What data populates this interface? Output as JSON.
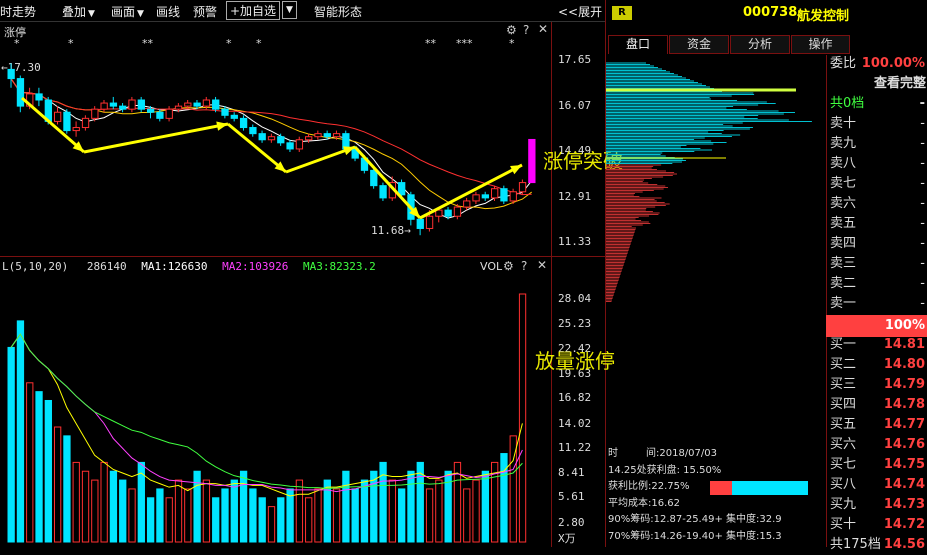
{
  "toolbar": {
    "timeshare": "时走势",
    "overlay": "叠加",
    "drawing": "画面",
    "line": "画线",
    "alert": "预警",
    "add_favorite": "+加自选",
    "smart_pattern": "智能形态",
    "expand": "<<展开"
  },
  "price_chart": {
    "title": "涨停",
    "high_marker": "←17.30",
    "low_marker": "11.68→",
    "axis_ticks": [
      "17.65",
      "16.07",
      "14.49",
      "12.91",
      "11.33"
    ],
    "annotation": "涨停突破",
    "stars": [
      "*",
      "*",
      "**",
      "*",
      "*",
      "**",
      "***",
      "*"
    ]
  },
  "volume_chart": {
    "indicator": "L(5,10,20)",
    "volume": "286140",
    "ma1_label": "MA1:126630",
    "ma2_label": "MA2:103926",
    "ma3_label": "MA3:82323.2",
    "name": "VOL",
    "axis_ticks": [
      "28.04",
      "25.23",
      "22.42",
      "19.63",
      "16.82",
      "14.02",
      "11.22",
      "8.41",
      "5.61",
      "2.80"
    ],
    "unit": "X万",
    "annotation": "放量涨停"
  },
  "colors": {
    "up": "#ff3030",
    "down": "#00e5ff",
    "ma1": "#ffffff",
    "ma2": "#ff40ff",
    "ma3": "#40ff40",
    "accent": "#ffff00"
  },
  "stock": {
    "badge": "R",
    "code": "000738",
    "name": "航发控制"
  },
  "tabs": [
    "盘口",
    "资金",
    "分析",
    "操作"
  ],
  "chip": {
    "time_label": "时",
    "date": "间:2018/07/03",
    "profit_at": "14.25处获利盘: 15.50%",
    "profit_ratio": "获利比例:22.75%",
    "avg_cost": "平均成本:16.62",
    "chip90": "90%筹码:12.87-25.49+ 集中度:32.9",
    "chip70": "70%筹码:14.26-19.40+ 集中度:15.3",
    "profit_fraction": 0.2275
  },
  "orderbook": {
    "ratio_label": "委比",
    "ratio_value": "100.00%",
    "view_all": "查看完整",
    "total_levels": "共0档",
    "middle_pct": "100%",
    "asks": [
      {
        "label": "卖十",
        "value": "-"
      },
      {
        "label": "卖九",
        "value": "-"
      },
      {
        "label": "卖八",
        "value": "-"
      },
      {
        "label": "卖七",
        "value": "-"
      },
      {
        "label": "卖六",
        "value": "-"
      },
      {
        "label": "卖五",
        "value": "-"
      },
      {
        "label": "卖四",
        "value": "-"
      },
      {
        "label": "卖三",
        "value": "-"
      },
      {
        "label": "卖二",
        "value": "-"
      },
      {
        "label": "卖一",
        "value": "-"
      }
    ],
    "bids": [
      {
        "label": "买一",
        "value": "14.81"
      },
      {
        "label": "买二",
        "value": "14.80"
      },
      {
        "label": "买三",
        "value": "14.79"
      },
      {
        "label": "买四",
        "value": "14.78"
      },
      {
        "label": "买五",
        "value": "14.77"
      },
      {
        "label": "买六",
        "value": "14.76"
      },
      {
        "label": "买七",
        "value": "14.75"
      },
      {
        "label": "买八",
        "value": "14.74"
      },
      {
        "label": "买九",
        "value": "14.73"
      },
      {
        "label": "买十",
        "value": "14.72"
      },
      {
        "label": "共175档",
        "value": "14.56"
      }
    ]
  },
  "chart_data": {
    "type": "candlestick",
    "ylim": [
      11.0,
      17.8
    ],
    "candles": [
      {
        "o": 17.1,
        "c": 16.8,
        "h": 17.3,
        "l": 16.5
      },
      {
        "o": 16.8,
        "c": 15.9,
        "h": 16.9,
        "l": 15.7
      },
      {
        "o": 15.9,
        "c": 16.3,
        "h": 16.5,
        "l": 15.8
      },
      {
        "o": 16.3,
        "c": 16.1,
        "h": 16.5,
        "l": 15.9
      },
      {
        "o": 16.1,
        "c": 15.4,
        "h": 16.2,
        "l": 15.3
      },
      {
        "o": 15.4,
        "c": 15.7,
        "h": 15.9,
        "l": 15.3
      },
      {
        "o": 15.7,
        "c": 15.1,
        "h": 15.8,
        "l": 15.0
      },
      {
        "o": 15.1,
        "c": 15.2,
        "h": 15.4,
        "l": 14.9
      },
      {
        "o": 15.2,
        "c": 15.5,
        "h": 15.6,
        "l": 15.1
      },
      {
        "o": 15.5,
        "c": 15.8,
        "h": 15.9,
        "l": 15.4
      },
      {
        "o": 15.8,
        "c": 16.0,
        "h": 16.1,
        "l": 15.7
      },
      {
        "o": 16.0,
        "c": 15.9,
        "h": 16.2,
        "l": 15.8
      },
      {
        "o": 15.9,
        "c": 15.8,
        "h": 16.0,
        "l": 15.7
      },
      {
        "o": 15.8,
        "c": 16.1,
        "h": 16.2,
        "l": 15.7
      },
      {
        "o": 16.1,
        "c": 15.8,
        "h": 16.2,
        "l": 15.7
      },
      {
        "o": 15.8,
        "c": 15.7,
        "h": 15.9,
        "l": 15.5
      },
      {
        "o": 15.7,
        "c": 15.5,
        "h": 15.8,
        "l": 15.4
      },
      {
        "o": 15.5,
        "c": 15.8,
        "h": 15.9,
        "l": 15.4
      },
      {
        "o": 15.8,
        "c": 15.9,
        "h": 16.0,
        "l": 15.7
      },
      {
        "o": 15.9,
        "c": 16.0,
        "h": 16.1,
        "l": 15.8
      },
      {
        "o": 16.0,
        "c": 15.9,
        "h": 16.1,
        "l": 15.8
      },
      {
        "o": 15.9,
        "c": 16.1,
        "h": 16.2,
        "l": 15.8
      },
      {
        "o": 16.1,
        "c": 15.8,
        "h": 16.2,
        "l": 15.7
      },
      {
        "o": 15.8,
        "c": 15.6,
        "h": 15.9,
        "l": 15.5
      },
      {
        "o": 15.6,
        "c": 15.5,
        "h": 15.7,
        "l": 15.4
      },
      {
        "o": 15.5,
        "c": 15.2,
        "h": 15.6,
        "l": 15.1
      },
      {
        "o": 15.2,
        "c": 15.0,
        "h": 15.3,
        "l": 14.9
      },
      {
        "o": 15.0,
        "c": 14.8,
        "h": 15.1,
        "l": 14.7
      },
      {
        "o": 14.8,
        "c": 14.9,
        "h": 15.0,
        "l": 14.7
      },
      {
        "o": 14.9,
        "c": 14.7,
        "h": 15.0,
        "l": 14.6
      },
      {
        "o": 14.7,
        "c": 14.5,
        "h": 14.8,
        "l": 14.4
      },
      {
        "o": 14.5,
        "c": 14.8,
        "h": 14.9,
        "l": 14.4
      },
      {
        "o": 14.8,
        "c": 14.9,
        "h": 15.0,
        "l": 14.7
      },
      {
        "o": 14.9,
        "c": 15.0,
        "h": 15.1,
        "l": 14.8
      },
      {
        "o": 15.0,
        "c": 14.9,
        "h": 15.1,
        "l": 14.8
      },
      {
        "o": 14.9,
        "c": 15.0,
        "h": 15.1,
        "l": 14.8
      },
      {
        "o": 15.0,
        "c": 14.5,
        "h": 15.1,
        "l": 14.4
      },
      {
        "o": 14.5,
        "c": 14.2,
        "h": 14.6,
        "l": 14.1
      },
      {
        "o": 14.2,
        "c": 13.8,
        "h": 14.3,
        "l": 13.7
      },
      {
        "o": 13.8,
        "c": 13.3,
        "h": 13.9,
        "l": 13.2
      },
      {
        "o": 13.3,
        "c": 12.9,
        "h": 13.4,
        "l": 12.8
      },
      {
        "o": 12.9,
        "c": 13.4,
        "h": 13.6,
        "l": 12.8
      },
      {
        "o": 13.4,
        "c": 13.0,
        "h": 13.5,
        "l": 12.9
      },
      {
        "o": 13.0,
        "c": 12.2,
        "h": 13.1,
        "l": 12.0
      },
      {
        "o": 12.2,
        "c": 11.9,
        "h": 12.3,
        "l": 11.68
      },
      {
        "o": 11.9,
        "c": 12.3,
        "h": 12.5,
        "l": 11.8
      },
      {
        "o": 12.3,
        "c": 12.5,
        "h": 12.6,
        "l": 12.1
      },
      {
        "o": 12.5,
        "c": 12.3,
        "h": 12.6,
        "l": 12.2
      },
      {
        "o": 12.3,
        "c": 12.6,
        "h": 12.7,
        "l": 12.2
      },
      {
        "o": 12.6,
        "c": 12.8,
        "h": 12.9,
        "l": 12.5
      },
      {
        "o": 12.8,
        "c": 13.0,
        "h": 13.1,
        "l": 12.7
      },
      {
        "o": 13.0,
        "c": 12.9,
        "h": 13.1,
        "l": 12.8
      },
      {
        "o": 12.9,
        "c": 13.2,
        "h": 13.3,
        "l": 12.8
      },
      {
        "o": 13.2,
        "c": 12.8,
        "h": 13.3,
        "l": 12.7
      },
      {
        "o": 12.8,
        "c": 13.1,
        "h": 13.2,
        "l": 12.7
      },
      {
        "o": 13.1,
        "c": 13.4,
        "h": 13.5,
        "l": 13.0
      },
      {
        "o": 13.4,
        "c": 14.81,
        "h": 14.81,
        "l": 13.4
      }
    ],
    "volumes": [
      22,
      25,
      18,
      17,
      16,
      13,
      12,
      9,
      8,
      7,
      9,
      8,
      7,
      6,
      9,
      5,
      6,
      5,
      7,
      6,
      8,
      7,
      5,
      6,
      7,
      8,
      6,
      5,
      4,
      5,
      6,
      7,
      5,
      6,
      7,
      6,
      8,
      6,
      7,
      8,
      9,
      7,
      6,
      8,
      9,
      6,
      7,
      8,
      9,
      6,
      7,
      8,
      9,
      10,
      12,
      28.04
    ]
  }
}
